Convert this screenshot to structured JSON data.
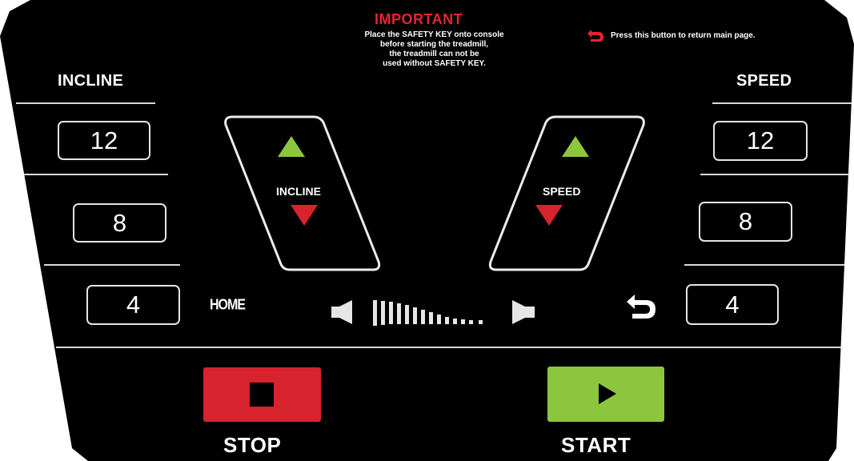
{
  "notice": {
    "title": "IMPORTANT",
    "lines": [
      "Place the SAFETY KEY onto console",
      "before starting the treadmill,",
      "the treadmill can not be",
      "used without SAFETY KEY."
    ],
    "return_hint": "Press this button to return main page."
  },
  "incline": {
    "title": "INCLINE",
    "presets": [
      "12",
      "8",
      "4"
    ],
    "pad_label": "INCLINE"
  },
  "speed": {
    "title": "SPEED",
    "presets": [
      "12",
      "8",
      "4"
    ],
    "pad_label": "SPEED"
  },
  "home_label": "HOME",
  "controls": {
    "stop_label": "STOP",
    "start_label": "START"
  },
  "colors": {
    "up_arrow": "#8cc63f",
    "down_arrow": "#d7232e",
    "stop_button": "#d7232e",
    "start_button": "#8cc63f",
    "notice_title": "#e8232e"
  }
}
